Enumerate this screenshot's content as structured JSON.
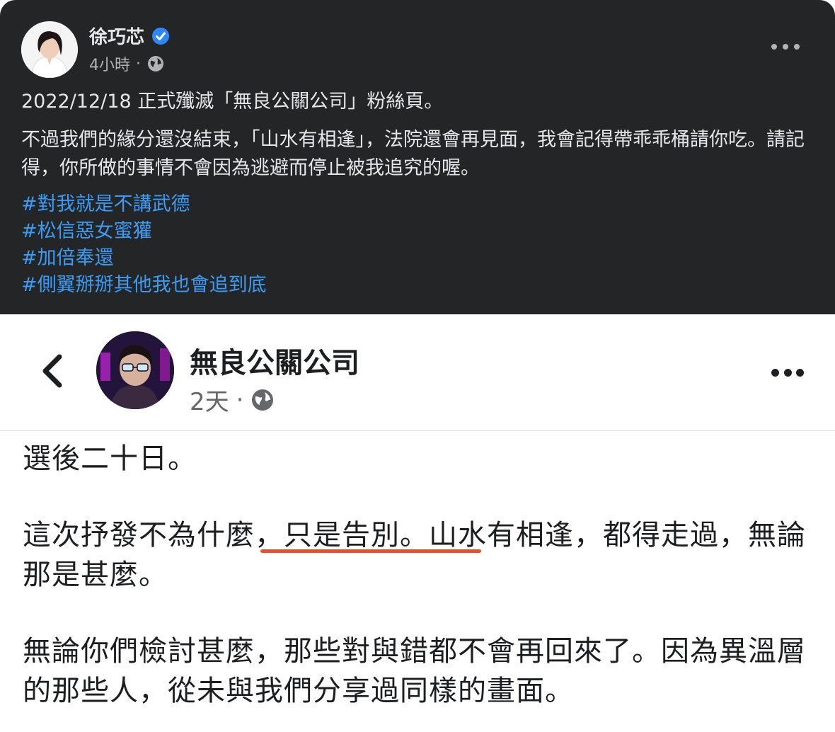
{
  "post": {
    "author": "徐巧芯",
    "time": "4小時",
    "separator": "·",
    "line1": "2022/12/18 正式殲滅「無良公關公司」粉絲頁。",
    "line2": "不過我們的緣分還沒結束，「山水有相逢」，法院還會再見面，我會記得帶乖乖桶請你吃。請記得，你所做的事情不會因為逃避而停止被我追究的喔。",
    "hashtags": [
      "#對我就是不講武德",
      "#松信惡女蜜獾",
      "#加倍奉還",
      "#側翼掰掰其他我也會追到底"
    ]
  },
  "embedded": {
    "page_name": "無良公關公司",
    "time": "2天",
    "separator": "·",
    "p1": "選後二十日。",
    "p2": "這次抒發不為什麼，只是告別。山水有相逢，都得走過，無論那是甚麼。",
    "p3": "無論你們檢討甚麼，那些對與錯都不會再回來了。因為異溫層的那些人，從未與我們分享過同樣的畫面。"
  },
  "colors": {
    "dark_bg": "#242526",
    "hashtag": "#3b9cf5",
    "verified": "#2d88ff",
    "underline": "#e5502f"
  },
  "icons": {
    "verified": "verified-badge-icon",
    "globe": "globe-icon",
    "more": "more-options-icon",
    "back": "chevron-left-icon"
  }
}
